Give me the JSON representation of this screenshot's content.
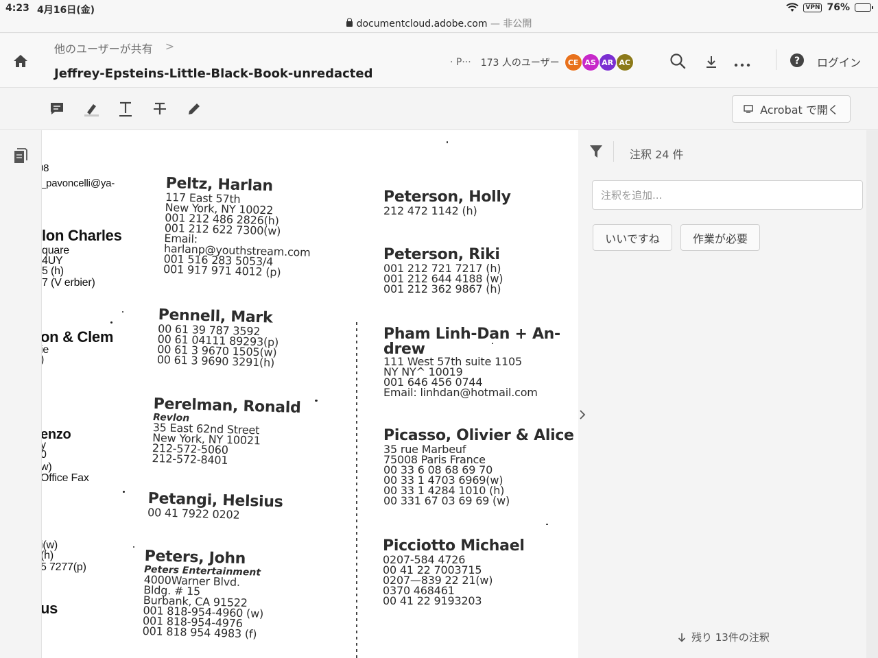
{
  "status_bar": {
    "time": "4:23",
    "date": "4月16日(金)",
    "url": "documentcloud.adobe.com",
    "private_label": "— 非公開",
    "vpn": "VPN",
    "battery": "76%",
    "battery_level": 0.76
  },
  "header": {
    "breadcrumb_parent": "他のユーザーが共有",
    "breadcrumb_sep": ">",
    "title": "Jeffrey-Epsteins-Little-Black-Book-unredacted",
    "share_truncated": "· P···",
    "user_count": "173 人のユーザー",
    "avatars": [
      {
        "initials": "CE",
        "color": "#e8711c"
      },
      {
        "initials": "AS",
        "color": "#c729c9"
      },
      {
        "initials": "AR",
        "color": "#7b2fd1"
      },
      {
        "initials": "AC",
        "color": "#8c7a1a"
      }
    ],
    "login": "ログイン"
  },
  "toolbar": {
    "open_acrobat": "Acrobat で開く"
  },
  "document": {
    "left_fragments": [
      "08",
      "t_pavoncelli@ya-",
      "lon Charles",
      "quare",
      "4UY",
      "5 (h)",
      "7 (V erbier)",
      "on & Clem",
      "ie",
      ")",
      "enzo",
      "y",
      "0",
      "w)",
      "Office Fax",
      "i(w)",
      "(h)",
      "5 7277(p)",
      "us"
    ],
    "col2": [
      {
        "name": "Peltz, Harlan",
        "lines": [
          "117 East 57th",
          "New York, NY 10022",
          "001 212 486 2826(h)",
          "001 212 622 7300(w)",
          "Email:",
          "harlanp@youthstream.com",
          "001 516 283 5053/4",
          "001 917 971 4012 (p)"
        ]
      },
      {
        "name": "Pennell, Mark",
        "lines": [
          "00 61 39 787 3592",
          "00 61 04111 89293(p)",
          "00 61 3 9670 1505(w)",
          "00 61 3 9690 3291(h)"
        ]
      },
      {
        "name": "Perelman, Ronald",
        "sub": "Revlon",
        "lines": [
          "35 East 62nd Street",
          "New York, NY 10021",
          "212-572-5060",
          "212-572-8401"
        ]
      },
      {
        "name": "Petangi, Helsius",
        "lines": [
          "00 41 7922 0202"
        ]
      },
      {
        "name": "Peters, John",
        "sub": "Peters Entertainment",
        "lines": [
          "4000Warner Blvd.",
          "Bldg. # 15",
          "Burbank, CA 91522",
          "001 818-954-4960 (w)",
          "001 818-954-4976",
          "001 818 954 4983 (f)"
        ]
      }
    ],
    "col3": [
      {
        "name": "Peterson, Holly",
        "lines": [
          "212 472 1142 (h)"
        ]
      },
      {
        "name": "Peterson, Riki",
        "lines": [
          "001 212 721 7217 (h)",
          "001 212 644 4188 (w)",
          "001 212 362 9867 (h)"
        ]
      },
      {
        "name": "Pham Linh-Dan + An-",
        "name2": "drew",
        "lines": [
          "111 West 57th suite 1105",
          "NY NY^ 10019",
          "001 646 456 0744",
          "Email: linhdan@hotmail.com"
        ]
      },
      {
        "name": "Picasso, Olivier & Alice",
        "lines": [
          "35 rue Marbeuf",
          "75008 Paris France",
          "00 33 6 08 68 69 70",
          "00 33 1 4703 6969(w)",
          "00 33 1 4284 1010 (h)",
          "00 331 67 03 69 69 (w)"
        ]
      },
      {
        "name": "Picciotto Michael",
        "lines": [
          "0207-584 4726",
          "00 41 22 7003715",
          "0207—839 22 21(w)",
          "0370 468461",
          "00 41 22 9193203"
        ]
      }
    ]
  },
  "panel": {
    "comment_count": "注釈 24 件",
    "input_placeholder": "注釈を追加...",
    "chip_like": "いいですね",
    "chip_needs_work": "作業が必要",
    "remaining": "残り 13件の注釈"
  }
}
